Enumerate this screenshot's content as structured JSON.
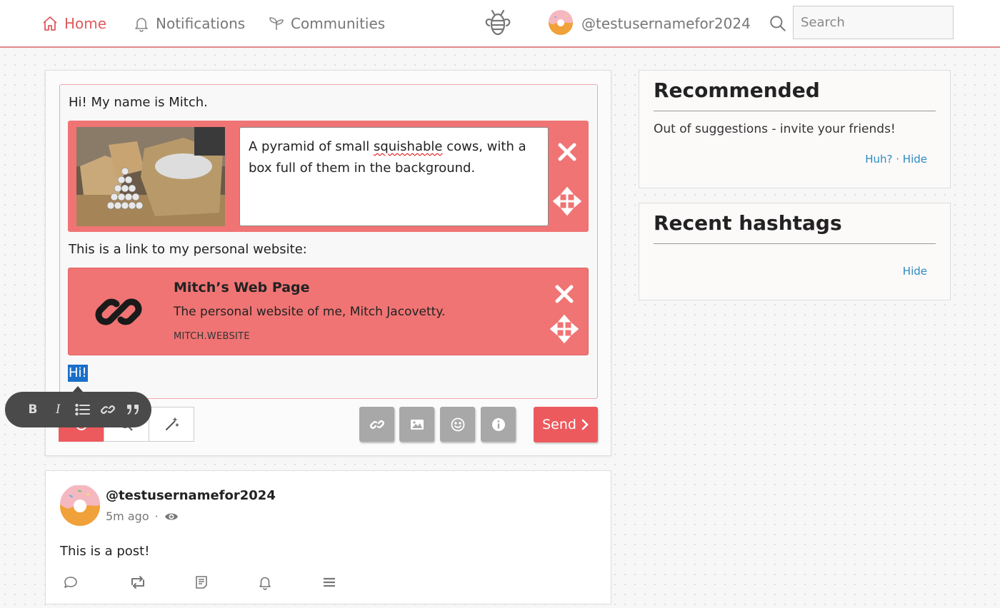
{
  "nav": {
    "home_label": "Home",
    "notifications_label": "Notifications",
    "communities_label": "Communities",
    "username": "@testusernamefor2024",
    "search_placeholder": "Search",
    "accent_color": "#e05a5e"
  },
  "composer": {
    "intro_text": "Hi! My name is Mitch.",
    "image_alt_pre": "A pyramid of small ",
    "image_alt_misspelled": "squishable",
    "image_alt_post": " cows, with a box full of them in the background.",
    "link_intro": "This is a link to my personal website:",
    "link_card": {
      "title": "Mitch’s Web Page",
      "description": "The personal website of me, Mitch Jacovetty.",
      "domain": "MITCH.WEBSITE"
    },
    "selected_text": "Hi!",
    "format_toolbar": [
      "bold-icon",
      "italic-icon",
      "list-icon",
      "link-icon",
      "quote-icon"
    ],
    "tools": [
      "link-icon",
      "image-icon",
      "emoji-icon",
      "info-icon"
    ],
    "send_label": "Send",
    "embed_color": "#f07474"
  },
  "post": {
    "username": "@testusernamefor2024",
    "time": "5m ago",
    "separator": "·",
    "body": "This is a post!",
    "actions": [
      "reply-icon",
      "repost-icon",
      "quote-icon",
      "notify-icon",
      "menu-icon"
    ]
  },
  "sidebar": {
    "recommended": {
      "title": "Recommended",
      "text": "Out of suggestions - invite your friends!",
      "huh_label": "Huh?",
      "separator": "·",
      "hide_label": "Hide"
    },
    "hashtags": {
      "title": "Recent hashtags",
      "hide_label": "Hide"
    }
  }
}
